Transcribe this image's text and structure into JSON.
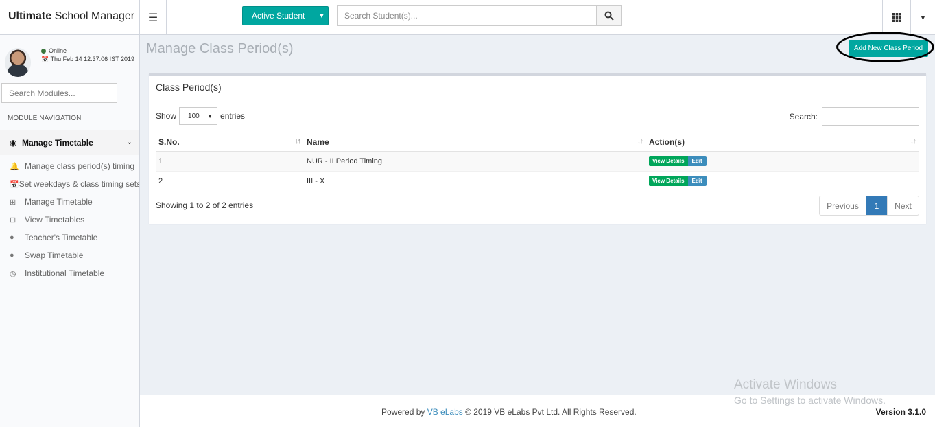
{
  "header": {
    "logo_bold": "Ultimate",
    "logo_rest": " School Manager",
    "active_student_label": "Active Student",
    "student_search_placeholder": "Search Student(s)..."
  },
  "sidebar": {
    "status": "Online",
    "datetime": "Thu Feb 14 12:37:06 IST 2019",
    "module_search_placeholder": "Search Modules...",
    "nav_header": "MODULE NAVIGATION",
    "group_label": "Manage Timetable",
    "items": [
      {
        "label": "Manage class period(s) timing",
        "icon": "bell-icon"
      },
      {
        "label": "Set weekdays & class timing sets",
        "icon": "calendar-icon"
      },
      {
        "label": "Manage Timetable",
        "icon": "calendar-plus-icon"
      },
      {
        "label": "View Timetables",
        "icon": "calendar-minus-icon"
      },
      {
        "label": "Teacher's Timetable",
        "icon": "user-icon"
      },
      {
        "label": "Swap Timetable",
        "icon": "user-icon"
      },
      {
        "label": "Institutional Timetable",
        "icon": "clock-icon"
      }
    ]
  },
  "page": {
    "title": "Manage Class Period(s)",
    "add_button": "Add New Class Period"
  },
  "box": {
    "title": "Class Period(s)",
    "show_label": "Show",
    "entries_value": "100",
    "entries_label": "entries",
    "search_label": "Search:",
    "columns": [
      "S.No.",
      "Name",
      "Action(s)"
    ],
    "rows": [
      {
        "sno": "1",
        "name": "NUR - II Period Timing",
        "view": "View Details",
        "edit": "Edit"
      },
      {
        "sno": "2",
        "name": "III - X",
        "view": "View Details",
        "edit": "Edit"
      }
    ],
    "showing": "Showing 1 to 2 of 2 entries",
    "pager": {
      "prev": "Previous",
      "current": "1",
      "next": "Next"
    }
  },
  "footer": {
    "powered_by": "Powered by ",
    "company_link": "VB eLabs",
    "copyright": " © 2019 VB eLabs Pvt Ltd. All Rights Reserved.",
    "version": "Version 3.1.0"
  },
  "watermark": {
    "line1": "Activate Windows",
    "line2": "Go to Settings to activate Windows."
  },
  "colors": {
    "accent": "#00a7a0",
    "view_button": "#00a65a",
    "edit_button": "#3c8dbc",
    "pager_active": "#337ab7"
  }
}
